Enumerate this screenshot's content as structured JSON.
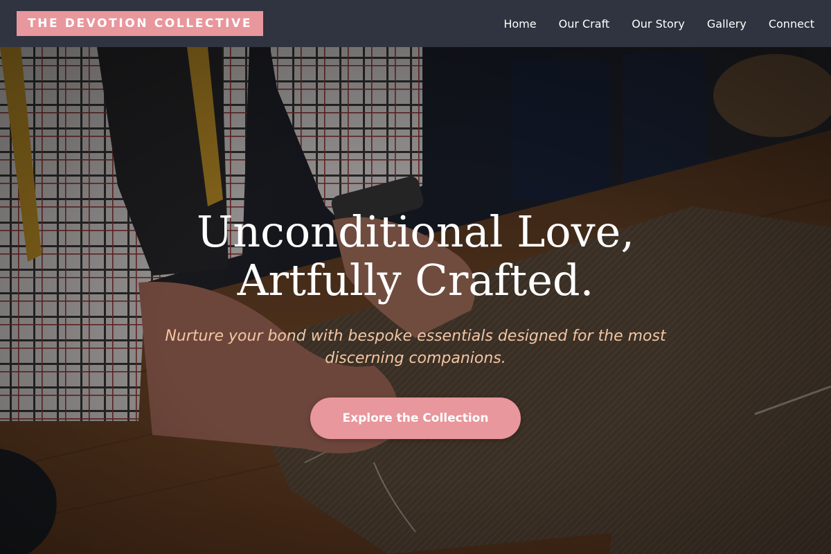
{
  "brand": {
    "name": "THE DEVOTION COLLECTIVE",
    "accent_color": "#e8979c",
    "header_background": "#2f3440"
  },
  "nav": {
    "items": [
      {
        "label": "Home"
      },
      {
        "label": "Our Craft"
      },
      {
        "label": "Our Story"
      },
      {
        "label": "Gallery"
      },
      {
        "label": "Connect"
      }
    ]
  },
  "hero": {
    "headline_line1": "Unconditional Love,",
    "headline_line2": "Artfully Crafted.",
    "subtitle": "Nurture your bond with bespoke essentials designed for the most discerning companions.",
    "cta_label": "Explore the Collection",
    "subtitle_color": "#f3c6a4",
    "background_image": "tailor cutting tweed fabric on a wooden workbench"
  }
}
